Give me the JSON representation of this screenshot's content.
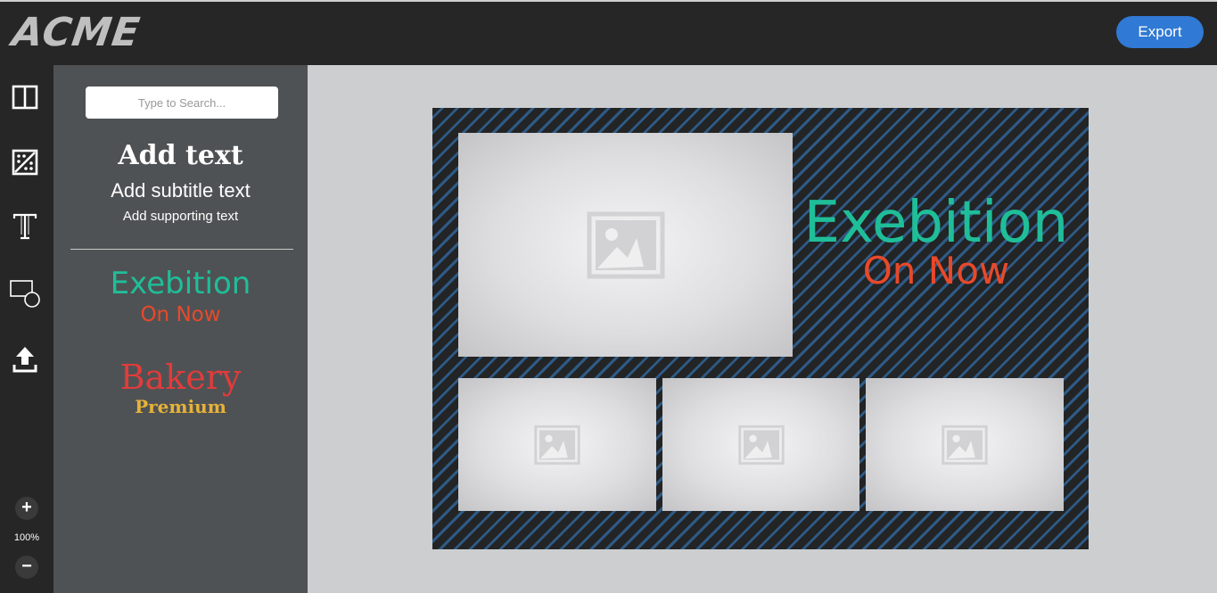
{
  "app": {
    "logo": "ACME",
    "export_label": "Export"
  },
  "tools": [
    {
      "name": "layout-icon"
    },
    {
      "name": "background-pattern-icon"
    },
    {
      "name": "text-tool-icon"
    },
    {
      "name": "shapes-icon"
    },
    {
      "name": "upload-icon"
    }
  ],
  "zoom": {
    "plus": "+",
    "minus": "−",
    "level": "100%"
  },
  "panel": {
    "search_placeholder": "Type to Search...",
    "add_text": "Add text",
    "add_subtitle": "Add subtitle text",
    "add_supporting": "Add supporting text",
    "presets": [
      {
        "title": "Exebition",
        "subtitle": "On Now",
        "title_color": "#1fbe99",
        "subtitle_color": "#e8492a"
      },
      {
        "title": "Bakery",
        "subtitle": "Premium",
        "title_color": "#e23b3b",
        "subtitle_color": "#e6b23a"
      }
    ]
  },
  "canvas": {
    "title": "Exebition",
    "subtitle": "On Now",
    "title_color": "#1fbe99",
    "subtitle_color": "#e8492a",
    "background_colors": [
      "#232425",
      "#2e5a85"
    ],
    "photo_icon": "image-placeholder-icon"
  },
  "colors": {
    "accent": "#3079d4",
    "toolbar": "#262626",
    "panel": "#4f5254"
  }
}
